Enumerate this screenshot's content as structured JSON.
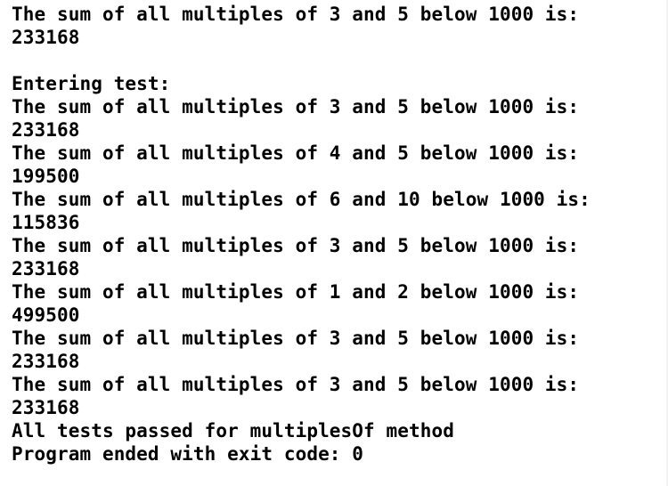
{
  "console": {
    "lines": [
      "The sum of all multiples of 3 and 5 below 1000 is:",
      "233168",
      "",
      "Entering test:",
      "The sum of all multiples of 3 and 5 below 1000 is:",
      "233168",
      "The sum of all multiples of 4 and 5 below 1000 is:",
      "199500",
      "The sum of all multiples of 6 and 10 below 1000 is:",
      "115836",
      "The sum of all multiples of 3 and 5 below 1000 is:",
      "233168",
      "The sum of all multiples of 1 and 2 below 1000 is:",
      "499500",
      "The sum of all multiples of 3 and 5 below 1000 is:",
      "233168",
      "The sum of all multiples of 3 and 5 below 1000 is:",
      "233168",
      "All tests passed for multiplesOf method",
      "Program ended with exit code: 0"
    ]
  }
}
